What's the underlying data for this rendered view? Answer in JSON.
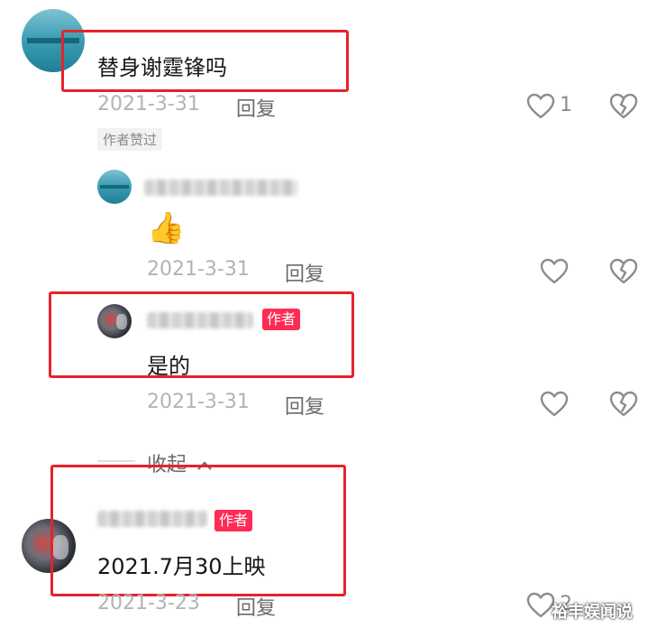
{
  "comments": [
    {
      "text": "替身谢霆锋吗",
      "date": "2021-3-31",
      "reply_label": "回复",
      "like_count": "1",
      "liked_by_author": "作者赞过"
    },
    {
      "text": "👍",
      "date": "2021-3-31",
      "reply_label": "回复"
    },
    {
      "text": "是的",
      "author_badge": "作者",
      "date": "2021-3-31",
      "reply_label": "回复"
    },
    {
      "collapse_label": "收起",
      "collapse_icon": "chevron-up-icon"
    },
    {
      "text": "2021.7月30上映",
      "author_badge": "作者",
      "date": "2021-3-23",
      "reply_label": "回复",
      "like_count": "2"
    }
  ],
  "icons": {
    "like": "heart-outline-icon",
    "dislike": "broken-heart-icon"
  },
  "watermark": "裕丰娱闻说",
  "colors": {
    "highlight_box": "#e5232c",
    "author_badge": "#fe2c55",
    "meta_text": "#b3b3b3"
  }
}
